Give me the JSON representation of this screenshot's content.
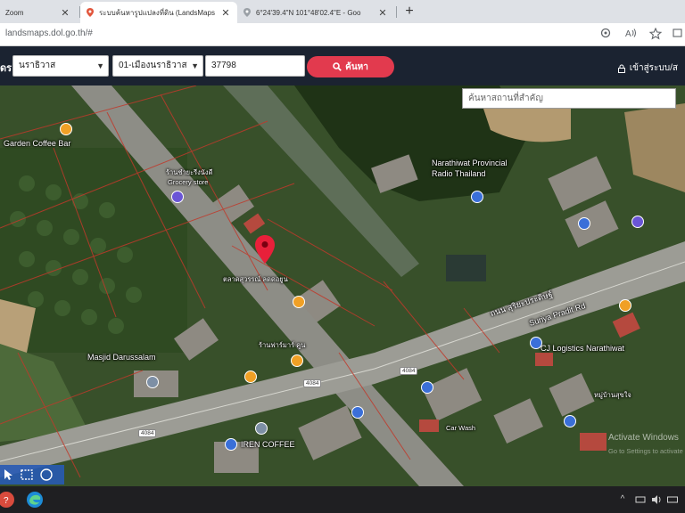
{
  "browser": {
    "tabs": [
      {
        "title": "Zoom",
        "active": false
      },
      {
        "title": "ระบบค้นหารูปแปลงที่ดิน (LandsMaps",
        "active": true
      },
      {
        "title": "6°24'39.4\"N 101°48'02.4\"E - Goo",
        "active": false
      }
    ],
    "new_tab_label": "+",
    "url": "landsmaps.dol.go.th/#"
  },
  "site": {
    "label_fragment": "ดร",
    "province": "นราธิวาส",
    "district": "01-เมืองนราธิวาส",
    "parcel_number": "37798",
    "search_button": "ค้นหา",
    "login_label": "เข้าสู่ระบบ/ส"
  },
  "map": {
    "search_placeholder": "ค้นหาสถานที่สำคัญ",
    "labels": {
      "garden_coffee": "Garden Coffee Bar",
      "grocery_th": "ร้านชำยะรีงนังดี",
      "grocery_en": "Grocery store",
      "radio_1": "Narathiwat Provincial",
      "radio_2": "Radio Thailand",
      "road_th": "ถนน สุริยะประดิษฐ์",
      "road_en": "Suriya Pradit Rd",
      "parcel_label": "ตลาดสุวรรณ์ ลดดอยูน",
      "masjid_1": "Masjid Darussalam",
      "cj_logistics": "CJ Logistics Narathiwat",
      "iren_coffee": "IREN COFFEE",
      "car_wash": "Car Wash",
      "village_th": "หมู่บ้านสุขใจ",
      "shop_th": "ร้านฟาร์มาร์ คูน",
      "route_badge": "4084"
    },
    "watermark": "Activate Windows",
    "watermark_sub": "Go to Settings to activate"
  },
  "colors": {
    "site_bar": "#1b2331",
    "search_button": "#e23a4e",
    "map_pin": "#e8203a",
    "taskbar": "#1f1f22"
  },
  "icons": {
    "address_bar": [
      "location-icon",
      "read-aloud-icon",
      "favorites-icon"
    ],
    "taskbar_apps": [
      "windows-logo-icon",
      "edge-icon"
    ],
    "tray": [
      "chevron-up-icon",
      "network-icon",
      "volume-icon",
      "keyboard-icon"
    ]
  }
}
